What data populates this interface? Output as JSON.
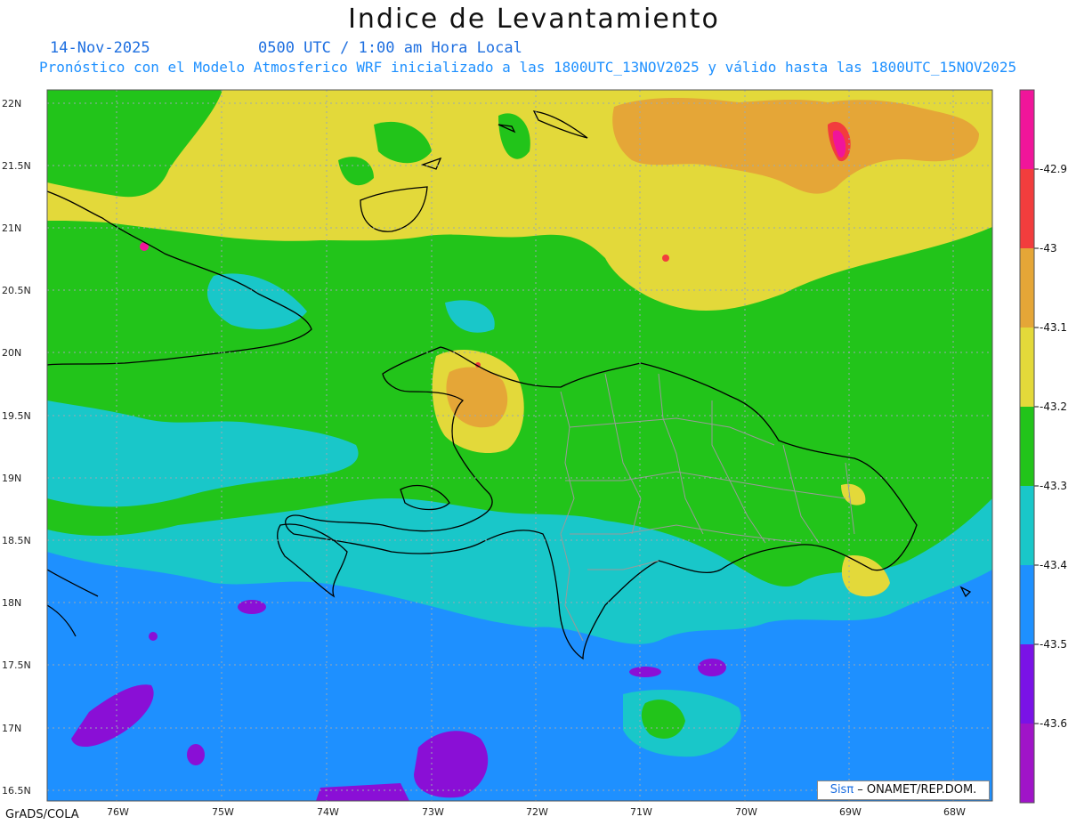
{
  "title": "Indice de Levantamiento",
  "date": "14-Nov-2025",
  "time": "0500 UTC / 1:00 am Hora Local",
  "subtitle": "Pronóstico con el Modelo Atmosferico WRF inicializado a las 1800UTC_13NOV2025 y válido hasta las  1800UTC_15NOV2025",
  "credit_prefix": "Sisπ",
  "credit_suffix": " – ONAMET/REP.DOM.",
  "software": "GrADS/COLA",
  "lat_labels": [
    "22N",
    "21.5N",
    "21N",
    "20.5N",
    "20N",
    "19.5N",
    "19N",
    "18.5N",
    "18N",
    "17.5N",
    "17N",
    "16.5N"
  ],
  "lon_labels": [
    "76W",
    "75W",
    "74W",
    "73W",
    "72W",
    "71W",
    "70W",
    "69W",
    "68W"
  ],
  "colorbar": {
    "labels": [
      "-42.9",
      "-43",
      "-43.1",
      "-43.2",
      "-43.3",
      "-43.4",
      "-43.5",
      "-43.6"
    ],
    "colors": [
      "#f0159a",
      "#f23d3d",
      "#e5a637",
      "#e3d93a",
      "#22c41a",
      "#19c7c9",
      "#1e90ff",
      "#7a12e6",
      "#a014c8"
    ]
  },
  "colors": {
    "orange": "#e5a637",
    "yellow": "#e3d93a",
    "green": "#22c41a",
    "cyan": "#19c7c9",
    "blue": "#1e90ff",
    "purple": "#8a0fd6",
    "magenta": "#f0159a",
    "red": "#f23d3d"
  }
}
